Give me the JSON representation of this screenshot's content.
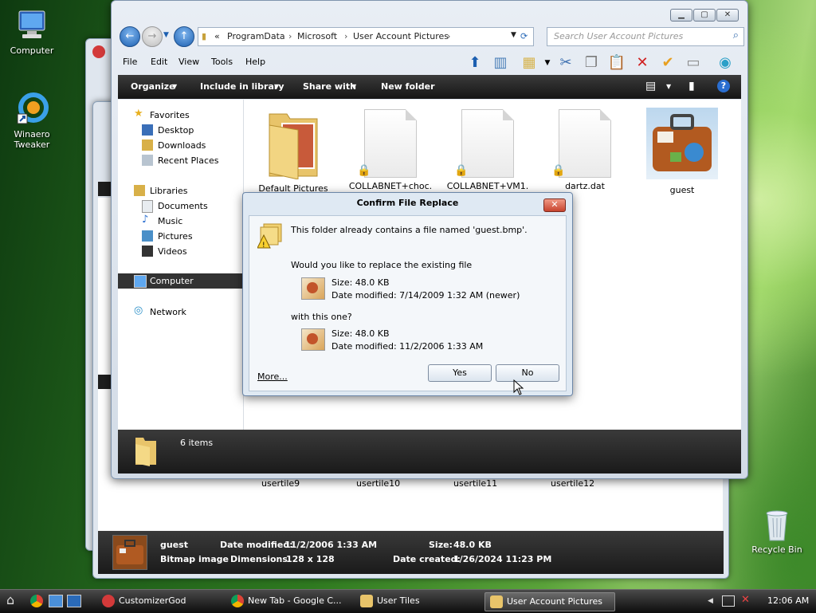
{
  "desktop": {
    "icons": [
      {
        "label": "Computer"
      },
      {
        "label": "Winaero Tweaker"
      },
      {
        "label": "Recycle Bin"
      }
    ]
  },
  "back_window": {
    "file_labels": [
      "usertile9",
      "usertile10",
      "usertile11",
      "usertile12"
    ],
    "details": {
      "name": "guest",
      "type": "Bitmap image",
      "date_modified_label": "Date modified:",
      "date_modified": "11/2/2006 1:33 AM",
      "dimensions_label": "Dimensions:",
      "dimensions": "128 x 128",
      "size_label": "Size:",
      "size": "48.0 KB",
      "date_created_label": "Date created:",
      "date_created": "1/26/2024 11:23 PM"
    }
  },
  "window": {
    "breadcrumb": [
      "«",
      "ProgramData",
      "Microsoft",
      "User Account Pictures"
    ],
    "search_placeholder": "Search User Account Pictures",
    "menu": [
      "File",
      "Edit",
      "View",
      "Tools",
      "Help"
    ],
    "commands": [
      "Organize",
      "Include in library",
      "Share with",
      "New folder"
    ],
    "nav": {
      "favorites": "Favorites",
      "favorites_items": [
        "Desktop",
        "Downloads",
        "Recent Places"
      ],
      "libraries": "Libraries",
      "libraries_items": [
        "Documents",
        "Music",
        "Pictures",
        "Videos"
      ],
      "computer": "Computer",
      "network": "Network"
    },
    "files": [
      {
        "name": "Default Pictures"
      },
      {
        "name": "COLLABNET+choc."
      },
      {
        "name": "COLLABNET+VM1."
      },
      {
        "name": "dartz.dat"
      },
      {
        "name": "guest"
      }
    ],
    "status": "6 items"
  },
  "dialog": {
    "title": "Confirm File Replace",
    "message": "This folder already contains a file named 'guest.bmp'.",
    "question": "Would you like to replace the existing file",
    "existing": {
      "size": "Size: 48.0 KB",
      "date": "Date modified: 7/14/2009 1:32 AM (newer)"
    },
    "with": "with this one?",
    "replacement": {
      "size": "Size: 48.0 KB",
      "date": "Date modified: 11/2/2006 1:33 AM"
    },
    "more": "More...",
    "yes": "Yes",
    "no": "No"
  },
  "taskbar": {
    "tasks": [
      "CustomizerGod",
      "New Tab - Google C...",
      "User Tiles",
      "User Account Pictures"
    ],
    "clock": "12:06 AM"
  }
}
